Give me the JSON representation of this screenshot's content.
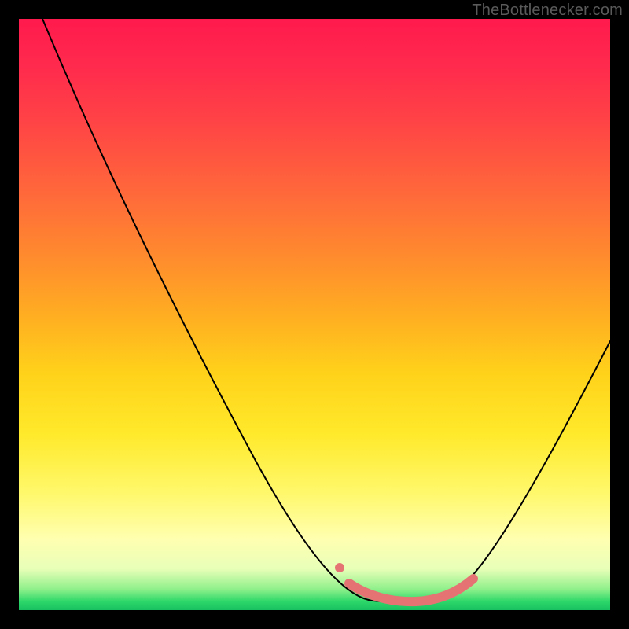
{
  "watermark": "TheBottlenecker.com",
  "chart_data": {
    "type": "line",
    "title": "",
    "xlabel": "",
    "ylabel": "",
    "xlim": [
      0,
      100
    ],
    "ylim": [
      0,
      100
    ],
    "grid": false,
    "legend": false,
    "background_gradient": {
      "orientation": "vertical",
      "stops": [
        {
          "pos": 0,
          "color": "#ff1a4d"
        },
        {
          "pos": 50,
          "color": "#ffd21a"
        },
        {
          "pos": 88,
          "color": "#ffffb0"
        },
        {
          "pos": 100,
          "color": "#18c060"
        }
      ]
    },
    "series": [
      {
        "name": "bottleneck-curve",
        "color": "#000000",
        "x": [
          4,
          10,
          18,
          26,
          34,
          42,
          50,
          56,
          60,
          64,
          68,
          72,
          76,
          82,
          88,
          94,
          100
        ],
        "y": [
          100,
          88,
          74,
          60,
          46,
          32,
          18,
          8,
          3,
          1,
          1,
          2,
          4,
          12,
          26,
          40,
          54
        ]
      }
    ],
    "highlight_region": {
      "name": "optimal-range",
      "color": "#e57373",
      "x": [
        56,
        60,
        64,
        68,
        72,
        76
      ],
      "y": [
        8,
        3,
        1,
        1,
        2,
        4
      ]
    },
    "annotations": []
  }
}
